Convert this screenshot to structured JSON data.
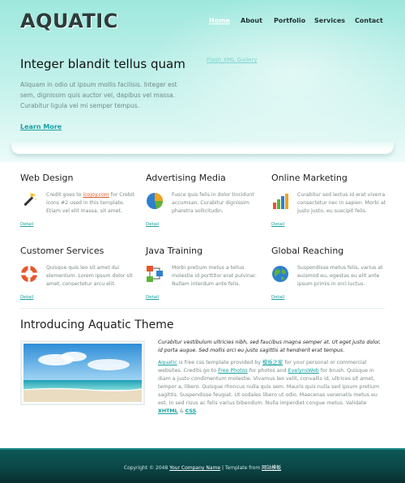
{
  "header": {
    "logo": "AQUATIC",
    "nav": [
      {
        "label": "Home",
        "active": true
      },
      {
        "label": "About",
        "active": false
      },
      {
        "label": "Portfolio",
        "active": false
      },
      {
        "label": "Services",
        "active": false
      },
      {
        "label": "Contact",
        "active": false
      }
    ]
  },
  "hero": {
    "title": "Integer blandit tellus quam",
    "text": "Aliquam in odio ut ipsum mollis facilisis. Integer est sem, dignissim quis auctor vel, dapibus vel massa. Curabitur ligula vel mi semper tempus.",
    "link": "Learn More",
    "flash_note": "Flash XML Gallery"
  },
  "services": [
    {
      "title": "Web Design",
      "icon": "magic-wand-icon",
      "text_pre": "Credit goes to ",
      "link": "icojoy.com",
      "text_post": " for Crebit icons #2 used in this template. Etiam vel elit massa, sit amet.",
      "detail": "Detail"
    },
    {
      "title": "Advertising Media",
      "icon": "pie-chart-icon",
      "text": "Fusce quis felis in dolor tincidunt accumsan. Curabitur dignissim pharetra sollicitudin.",
      "detail": "Detail"
    },
    {
      "title": "Online Marketing",
      "icon": "bar-chart-icon",
      "text": "Curabitur sed lectus id erat viverra consectetur nec in sapien. Morbi at justo justo, eu suscipit felis.",
      "detail": "Detail"
    },
    {
      "title": "Customer Services",
      "icon": "lifebuoy-icon",
      "text": "Quisque quis leo sit amet dui elementum. Lorem ipsum dolor sit amet, consectetur arcu elit.",
      "detail": "Detail"
    },
    {
      "title": "Java Training",
      "icon": "network-diagram-icon",
      "text": "Morbi pretium metus a tellus molestie id porttitor erat pulvinar. Nullam interdum ante felis.",
      "detail": "Detail"
    },
    {
      "title": "Global Reaching",
      "icon": "globe-icon",
      "text": "Suspendisse metus felis, varius at euismod eu, egestas eu elit ante ipsum primis in orci luctus.",
      "detail": "Detail"
    }
  ],
  "intro": {
    "title": "Introducing Aquatic Theme",
    "lead": "Curabitur vestibulum ultricies nibh, sed faucibus magna semper at. Ut eget justo dolor, id porta augue. Sed mollis orci eu justo sagittis at hendrerit erat tempus.",
    "body_parts": {
      "p1": "Aquatic",
      "p2": " is free css template provided by ",
      "p3": "模板之家",
      "p4": " for your personal or commercial websites. Credits go to ",
      "p5": "Free Photos",
      "p6": " for photos and ",
      "p7": "EvelynsWeb",
      "p8": " for brush. Quisque in diam a justo condimentum molestie. Vivamus leo velit, convallis id, ultrices sit amet, tempor a, libero. Quisque rhoncus nulla quis sem. Mauris quis nulla sed ipsum pretium sagittis. Suspendisse feugiat. Ut sodales libero ut odio. Maecenas venenatis metus eu est. In sed risus ac felis varius bibendum. Nulla imperdiet congue metus. Validate ",
      "p9": "XHTML",
      "p10": " & ",
      "p11": "CSS",
      "p12": "."
    }
  },
  "footer": {
    "pre": "Copyright © 2048 ",
    "company": "Your Company Name",
    "mid": " | Template from ",
    "source": "网站模板"
  },
  "colors": {
    "accent": "#17a0a0",
    "footer_bg": "#0b4747",
    "hero_bg": "#b8efe8"
  }
}
